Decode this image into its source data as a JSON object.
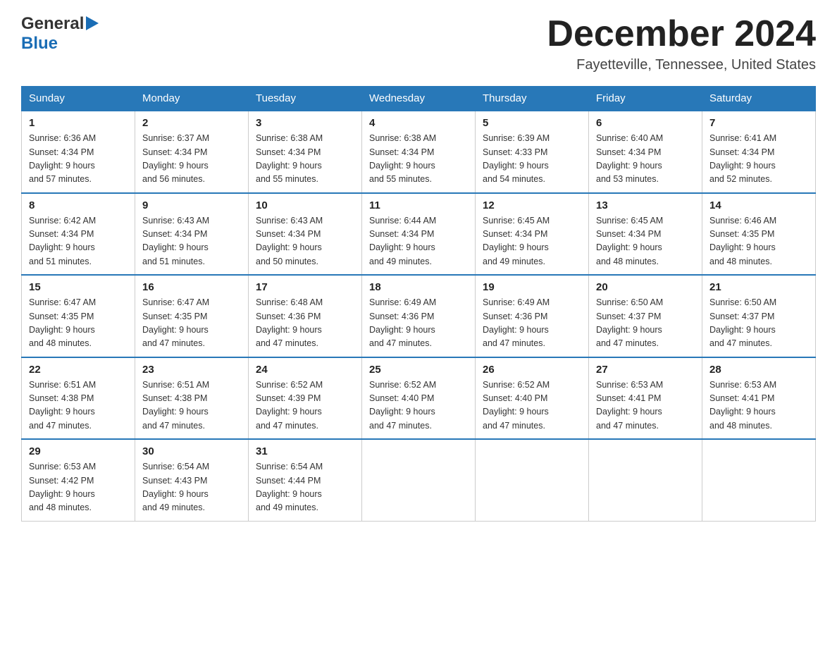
{
  "header": {
    "logo_general": "General",
    "logo_blue": "Blue",
    "month_title": "December 2024",
    "location": "Fayetteville, Tennessee, United States"
  },
  "days_of_week": [
    "Sunday",
    "Monday",
    "Tuesday",
    "Wednesday",
    "Thursday",
    "Friday",
    "Saturday"
  ],
  "weeks": [
    [
      {
        "day": "1",
        "sunrise": "6:36 AM",
        "sunset": "4:34 PM",
        "daylight": "9 hours and 57 minutes."
      },
      {
        "day": "2",
        "sunrise": "6:37 AM",
        "sunset": "4:34 PM",
        "daylight": "9 hours and 56 minutes."
      },
      {
        "day": "3",
        "sunrise": "6:38 AM",
        "sunset": "4:34 PM",
        "daylight": "9 hours and 55 minutes."
      },
      {
        "day": "4",
        "sunrise": "6:38 AM",
        "sunset": "4:34 PM",
        "daylight": "9 hours and 55 minutes."
      },
      {
        "day": "5",
        "sunrise": "6:39 AM",
        "sunset": "4:33 PM",
        "daylight": "9 hours and 54 minutes."
      },
      {
        "day": "6",
        "sunrise": "6:40 AM",
        "sunset": "4:34 PM",
        "daylight": "9 hours and 53 minutes."
      },
      {
        "day": "7",
        "sunrise": "6:41 AM",
        "sunset": "4:34 PM",
        "daylight": "9 hours and 52 minutes."
      }
    ],
    [
      {
        "day": "8",
        "sunrise": "6:42 AM",
        "sunset": "4:34 PM",
        "daylight": "9 hours and 51 minutes."
      },
      {
        "day": "9",
        "sunrise": "6:43 AM",
        "sunset": "4:34 PM",
        "daylight": "9 hours and 51 minutes."
      },
      {
        "day": "10",
        "sunrise": "6:43 AM",
        "sunset": "4:34 PM",
        "daylight": "9 hours and 50 minutes."
      },
      {
        "day": "11",
        "sunrise": "6:44 AM",
        "sunset": "4:34 PM",
        "daylight": "9 hours and 49 minutes."
      },
      {
        "day": "12",
        "sunrise": "6:45 AM",
        "sunset": "4:34 PM",
        "daylight": "9 hours and 49 minutes."
      },
      {
        "day": "13",
        "sunrise": "6:45 AM",
        "sunset": "4:34 PM",
        "daylight": "9 hours and 48 minutes."
      },
      {
        "day": "14",
        "sunrise": "6:46 AM",
        "sunset": "4:35 PM",
        "daylight": "9 hours and 48 minutes."
      }
    ],
    [
      {
        "day": "15",
        "sunrise": "6:47 AM",
        "sunset": "4:35 PM",
        "daylight": "9 hours and 48 minutes."
      },
      {
        "day": "16",
        "sunrise": "6:47 AM",
        "sunset": "4:35 PM",
        "daylight": "9 hours and 47 minutes."
      },
      {
        "day": "17",
        "sunrise": "6:48 AM",
        "sunset": "4:36 PM",
        "daylight": "9 hours and 47 minutes."
      },
      {
        "day": "18",
        "sunrise": "6:49 AM",
        "sunset": "4:36 PM",
        "daylight": "9 hours and 47 minutes."
      },
      {
        "day": "19",
        "sunrise": "6:49 AM",
        "sunset": "4:36 PM",
        "daylight": "9 hours and 47 minutes."
      },
      {
        "day": "20",
        "sunrise": "6:50 AM",
        "sunset": "4:37 PM",
        "daylight": "9 hours and 47 minutes."
      },
      {
        "day": "21",
        "sunrise": "6:50 AM",
        "sunset": "4:37 PM",
        "daylight": "9 hours and 47 minutes."
      }
    ],
    [
      {
        "day": "22",
        "sunrise": "6:51 AM",
        "sunset": "4:38 PM",
        "daylight": "9 hours and 47 minutes."
      },
      {
        "day": "23",
        "sunrise": "6:51 AM",
        "sunset": "4:38 PM",
        "daylight": "9 hours and 47 minutes."
      },
      {
        "day": "24",
        "sunrise": "6:52 AM",
        "sunset": "4:39 PM",
        "daylight": "9 hours and 47 minutes."
      },
      {
        "day": "25",
        "sunrise": "6:52 AM",
        "sunset": "4:40 PM",
        "daylight": "9 hours and 47 minutes."
      },
      {
        "day": "26",
        "sunrise": "6:52 AM",
        "sunset": "4:40 PM",
        "daylight": "9 hours and 47 minutes."
      },
      {
        "day": "27",
        "sunrise": "6:53 AM",
        "sunset": "4:41 PM",
        "daylight": "9 hours and 47 minutes."
      },
      {
        "day": "28",
        "sunrise": "6:53 AM",
        "sunset": "4:41 PM",
        "daylight": "9 hours and 48 minutes."
      }
    ],
    [
      {
        "day": "29",
        "sunrise": "6:53 AM",
        "sunset": "4:42 PM",
        "daylight": "9 hours and 48 minutes."
      },
      {
        "day": "30",
        "sunrise": "6:54 AM",
        "sunset": "4:43 PM",
        "daylight": "9 hours and 49 minutes."
      },
      {
        "day": "31",
        "sunrise": "6:54 AM",
        "sunset": "4:44 PM",
        "daylight": "9 hours and 49 minutes."
      },
      null,
      null,
      null,
      null
    ]
  ],
  "labels": {
    "sunrise": "Sunrise:",
    "sunset": "Sunset:",
    "daylight": "Daylight:"
  }
}
